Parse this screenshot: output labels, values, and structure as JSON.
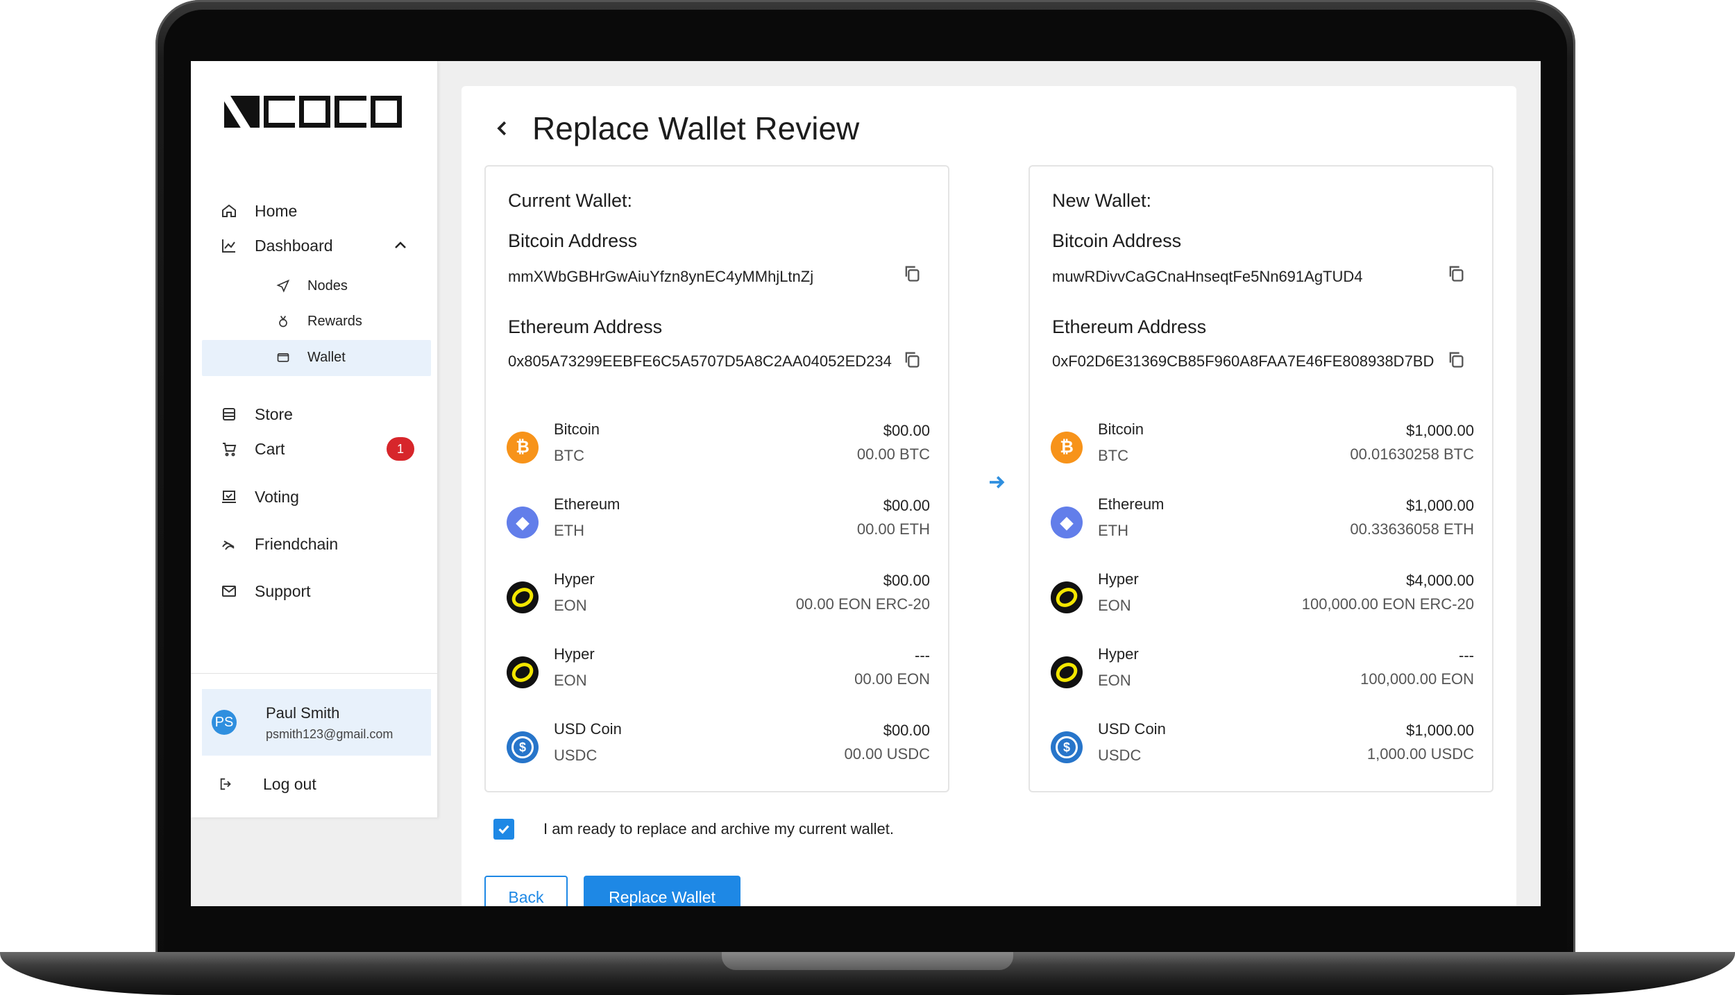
{
  "brand": {
    "logo_text": "nero"
  },
  "sidebar": {
    "items": [
      {
        "label": "Home",
        "icon": "home-icon"
      },
      {
        "label": "Dashboard",
        "icon": "chart-icon"
      },
      {
        "label": "Store",
        "icon": "store-icon"
      },
      {
        "label": "Cart",
        "icon": "cart-icon",
        "badge": "1"
      },
      {
        "label": "Voting",
        "icon": "voting-icon"
      },
      {
        "label": "Friendchain",
        "icon": "friendchain-icon"
      },
      {
        "label": "Support",
        "icon": "mail-icon"
      }
    ],
    "sub_items": [
      {
        "label": "Nodes",
        "icon": "send-icon"
      },
      {
        "label": "Rewards",
        "icon": "medal-icon"
      },
      {
        "label": "Wallet",
        "icon": "wallet-icon",
        "active": true
      }
    ],
    "user": {
      "initials": "PS",
      "name": "Paul Smith",
      "email": "psmith123@gmail.com"
    },
    "logout_label": "Log out"
  },
  "page": {
    "title": "Replace Wallet Review"
  },
  "current_wallet": {
    "heading": "Current Wallet:",
    "btc_label": "Bitcoin Address",
    "btc_address": "mmXWbGBHrGwAiuYfzn8ynEC4yMMhjLtnZj",
    "eth_label": "Ethereum Address",
    "eth_address": "0x805A73299EEBFE6C5A5707D5A8C2AA04052ED234",
    "assets": [
      {
        "name": "Bitcoin",
        "symbol": "BTC",
        "value": "$00.00",
        "amount": "00.00 BTC"
      },
      {
        "name": "Ethereum",
        "symbol": "ETH",
        "value": "$00.00",
        "amount": "00.00 ETH"
      },
      {
        "name": "Hyper",
        "symbol": "EON",
        "value": "$00.00",
        "amount": "00.00 EON ERC-20"
      },
      {
        "name": "Hyper",
        "symbol": "EON",
        "value": "---",
        "amount": "00.00 EON"
      },
      {
        "name": "USD Coin",
        "symbol": "USDC",
        "value": "$00.00",
        "amount": "00.00 USDC"
      }
    ]
  },
  "new_wallet": {
    "heading": "New Wallet:",
    "btc_label": "Bitcoin Address",
    "btc_address": "muwRDivvCaGCnaHnseqtFe5Nn691AgTUD4",
    "eth_label": "Ethereum Address",
    "eth_address": "0xF02D6E31369CB85F960A8FAA7E46FE808938D7BD",
    "assets": [
      {
        "name": "Bitcoin",
        "symbol": "BTC",
        "value": "$1,000.00",
        "amount": "00.01630258 BTC"
      },
      {
        "name": "Ethereum",
        "symbol": "ETH",
        "value": "$1,000.00",
        "amount": "00.33636058 ETH"
      },
      {
        "name": "Hyper",
        "symbol": "EON",
        "value": "$4,000.00",
        "amount": "100,000.00 EON ERC-20"
      },
      {
        "name": "Hyper",
        "symbol": "EON",
        "value": "---",
        "amount": "100,000.00 EON"
      },
      {
        "name": "USD Coin",
        "symbol": "USDC",
        "value": "$1,000.00",
        "amount": "1,000.00 USDC"
      }
    ]
  },
  "confirm": {
    "checked": true,
    "text": "I am ready to replace and archive my current wallet."
  },
  "buttons": {
    "back": "Back",
    "replace": "Replace Wallet"
  },
  "colors": {
    "accent": "#1e88e5",
    "badge": "#d7262b",
    "active_bg": "#e8f1fb",
    "btc": "#f7931a",
    "eth": "#627eea",
    "usdc": "#2775ca",
    "eon": "#f3e600"
  }
}
